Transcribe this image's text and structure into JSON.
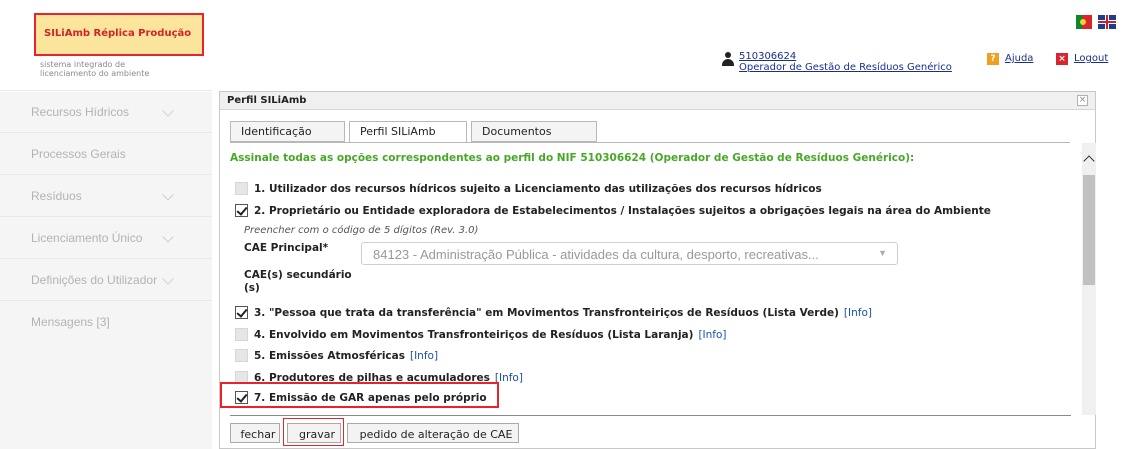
{
  "brand": {
    "name": "SILiAmb Réplica Produção",
    "subtitle_line1": "sistema integrado de",
    "subtitle_line2": "licenciamento do ambiente"
  },
  "sidebar": {
    "items": [
      {
        "label": "Recursos Hídricos"
      },
      {
        "label": "Processos Gerais"
      },
      {
        "label": "Resíduos"
      },
      {
        "label": "Licenciamento Único"
      },
      {
        "label": "Definições do Utilizador"
      },
      {
        "label": "Mensagens [3]"
      }
    ]
  },
  "header": {
    "user_nif": "510306624",
    "user_role": "Operador de Gestão de Resíduos Genérico",
    "help_label": "Ajuda",
    "logout_label": "Logout"
  },
  "dialog": {
    "title": "Perfil SILiAmb",
    "close": "×",
    "tabs": [
      {
        "label": "Identificação",
        "active": false
      },
      {
        "label": "Perfil SILiAmb",
        "active": true
      },
      {
        "label": "Documentos",
        "active": false
      }
    ],
    "intro": "Assinale todas as opções correspondentes ao perfil do NIF 510306624 (Operador de Gestão de Resíduos Genérico):",
    "options": [
      {
        "label": "1. Utilizador dos recursos hídricos sujeito a Licenciamento das utilizações dos recursos hídricos",
        "checked": false,
        "info": ""
      },
      {
        "label": "2. Proprietário ou Entidade exploradora de Estabelecimentos / Instalações sujeitos a obrigações legais na área do Ambiente",
        "checked": true,
        "info": ""
      },
      {
        "label": "3. \"Pessoa que trata da transferência\" em Movimentos Transfronteiriços de Resíduos (Lista Verde)",
        "checked": true,
        "info": "[Info]"
      },
      {
        "label": "4. Envolvido em Movimentos Transfronteiriços de Resíduos (Lista Laranja)",
        "checked": false,
        "info": "[Info]"
      },
      {
        "label": "5. Emissões Atmosféricas",
        "checked": false,
        "info": "[Info]"
      },
      {
        "label": "6. Produtores de pilhas e acumuladores",
        "checked": false,
        "info": "[Info]"
      },
      {
        "label": "7. Emissão de GAR apenas pelo próprio",
        "checked": true,
        "info": ""
      }
    ],
    "cae": {
      "hint": "Preencher com o código de 5 dígitos (Rev. 3.0)",
      "principal_label": "CAE Principal*",
      "principal_value": "84123 - Administração Pública - atividades da cultura, desporto, recreativas...",
      "secondary_label_line1": "CAE(s) secundário",
      "secondary_label_line2": "(s)"
    },
    "buttons": {
      "close": "fechar",
      "save": "gravar",
      "request_cae": "pedido de alteração de CAE"
    }
  },
  "colors": {
    "accent_green": "#47a827",
    "link_blue": "#1a2f8a",
    "highlight_red": "#e8232c"
  }
}
